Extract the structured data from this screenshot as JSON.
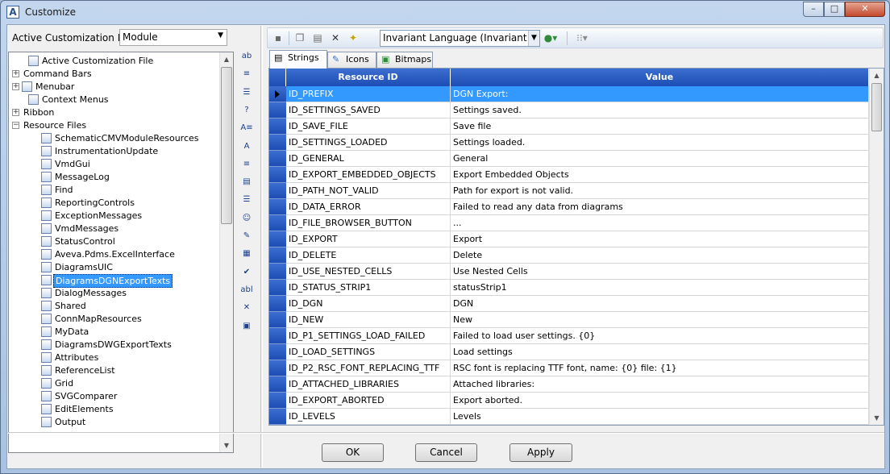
{
  "window": {
    "title": "Customize",
    "app_icon": "A",
    "minimize": "–",
    "maximize": "□",
    "close": "✕"
  },
  "left_panel": {
    "acf_label": "Active Customization File",
    "acf_value": "Module",
    "tree": [
      {
        "label": "Active Customization File",
        "level": 1,
        "expander": "",
        "icon": "file-icon"
      },
      {
        "label": "Command Bars",
        "level": 0,
        "expander": "+",
        "icon": ""
      },
      {
        "label": "Menubar",
        "level": 0,
        "expander": "+",
        "icon": "menu-icon"
      },
      {
        "label": "Context Menus",
        "level": 1,
        "expander": "",
        "icon": "context-menu-icon"
      },
      {
        "label": "Ribbon",
        "level": 0,
        "expander": "+",
        "icon": ""
      },
      {
        "label": "Resource Files",
        "level": 0,
        "expander": "−",
        "icon": ""
      },
      {
        "label": "SchematicCMVModuleResources",
        "level": 2,
        "expander": "",
        "icon": "resource-icon"
      },
      {
        "label": "InstrumentationUpdate",
        "level": 2,
        "expander": "",
        "icon": "resource-icon"
      },
      {
        "label": "VmdGui",
        "level": 2,
        "expander": "",
        "icon": "resource-icon"
      },
      {
        "label": "MessageLog",
        "level": 2,
        "expander": "",
        "icon": "resource-icon"
      },
      {
        "label": "Find",
        "level": 2,
        "expander": "",
        "icon": "resource-icon"
      },
      {
        "label": "ReportingControls",
        "level": 2,
        "expander": "",
        "icon": "resource-icon"
      },
      {
        "label": "ExceptionMessages",
        "level": 2,
        "expander": "",
        "icon": "resource-icon"
      },
      {
        "label": "VmdMessages",
        "level": 2,
        "expander": "",
        "icon": "resource-icon"
      },
      {
        "label": "StatusControl",
        "level": 2,
        "expander": "",
        "icon": "resource-icon"
      },
      {
        "label": "Aveva.Pdms.ExcelInterface",
        "level": 2,
        "expander": "",
        "icon": "resource-icon"
      },
      {
        "label": "DiagramsUIC",
        "level": 2,
        "expander": "",
        "icon": "resource-icon"
      },
      {
        "label": "DiagramsDGNExportTexts",
        "level": 2,
        "expander": "",
        "icon": "resource-icon",
        "selected": true
      },
      {
        "label": "DialogMessages",
        "level": 2,
        "expander": "",
        "icon": "resource-icon"
      },
      {
        "label": "Shared",
        "level": 2,
        "expander": "",
        "icon": "resource-icon"
      },
      {
        "label": "ConnMapResources",
        "level": 2,
        "expander": "",
        "icon": "resource-icon"
      },
      {
        "label": "MyData",
        "level": 2,
        "expander": "",
        "icon": "resource-icon"
      },
      {
        "label": "DiagramsDWGExportTexts",
        "level": 2,
        "expander": "",
        "icon": "resource-icon"
      },
      {
        "label": "Attributes",
        "level": 2,
        "expander": "",
        "icon": "resource-icon"
      },
      {
        "label": "ReferenceList",
        "level": 2,
        "expander": "",
        "icon": "resource-icon"
      },
      {
        "label": "Grid",
        "level": 2,
        "expander": "",
        "icon": "resource-icon"
      },
      {
        "label": "SVGComparer",
        "level": 2,
        "expander": "",
        "icon": "resource-icon"
      },
      {
        "label": "EditElements",
        "level": 2,
        "expander": "",
        "icon": "resource-icon"
      },
      {
        "label": "Output",
        "level": 2,
        "expander": "",
        "icon": "resource-icon"
      }
    ]
  },
  "vertical_toolbar": [
    {
      "icon": "textbox-icon",
      "glyph": "ab"
    },
    {
      "icon": "combobox-icon",
      "glyph": "≡"
    },
    {
      "icon": "list-icon",
      "glyph": "☰"
    },
    {
      "icon": "help-icon",
      "glyph": "?"
    },
    {
      "icon": "label-icon",
      "glyph": "A≡"
    },
    {
      "icon": "font-icon",
      "glyph": "A"
    },
    {
      "icon": "combo-list-icon",
      "glyph": "≡"
    },
    {
      "icon": "panel-icon",
      "glyph": "▤"
    },
    {
      "icon": "listview-icon",
      "glyph": "☰"
    },
    {
      "icon": "smiley-icon",
      "glyph": "☺"
    },
    {
      "icon": "edit-list-icon",
      "glyph": "✎"
    },
    {
      "icon": "image-list-icon",
      "glyph": "▦"
    },
    {
      "icon": "checkbox-icon",
      "glyph": "✔"
    },
    {
      "icon": "abl-textbox-icon",
      "glyph": "abl"
    },
    {
      "icon": "delete-icon",
      "glyph": "✕"
    },
    {
      "icon": "image-icon",
      "glyph": "▣"
    }
  ],
  "toolbar": {
    "language_value": "Invariant Language (Invariant C",
    "icons": [
      "save-icon",
      "copy-icon",
      "paste-icon",
      "delete-icon",
      "new-resource-icon",
      "globe-icon",
      "grid-options-icon"
    ]
  },
  "tabs": [
    {
      "label": "Strings",
      "icon": "strings-tab-icon",
      "active": true
    },
    {
      "label": "Icons",
      "icon": "icons-tab-icon",
      "active": false
    },
    {
      "label": "Bitmaps",
      "icon": "bitmaps-tab-icon",
      "active": false
    }
  ],
  "grid": {
    "columns": [
      "Resource ID",
      "Value"
    ],
    "rows": [
      [
        "ID_PREFIX",
        "DGN Export:"
      ],
      [
        "ID_SETTINGS_SAVED",
        "Settings saved."
      ],
      [
        "ID_SAVE_FILE",
        "Save file"
      ],
      [
        "ID_SETTINGS_LOADED",
        "Settings loaded."
      ],
      [
        "ID_GENERAL",
        "General"
      ],
      [
        "ID_EXPORT_EMBEDDED_OBJECTS",
        "Export Embedded Objects"
      ],
      [
        "ID_PATH_NOT_VALID",
        "Path for export is not valid."
      ],
      [
        "ID_DATA_ERROR",
        "Failed to read any data from diagrams"
      ],
      [
        "ID_FILE_BROWSER_BUTTON",
        "..."
      ],
      [
        "ID_EXPORT",
        "Export"
      ],
      [
        "ID_DELETE",
        "Delete"
      ],
      [
        "ID_USE_NESTED_CELLS",
        "Use Nested Cells"
      ],
      [
        "ID_STATUS_STRIP1",
        "statusStrip1"
      ],
      [
        "ID_DGN",
        "DGN"
      ],
      [
        "ID_NEW",
        "New"
      ],
      [
        "ID_P1_SETTINGS_LOAD_FAILED",
        "Failed to load user settings. {0}"
      ],
      [
        "ID_LOAD_SETTINGS",
        "Load settings"
      ],
      [
        "ID_P2_RSC_FONT_REPLACING_TTF",
        "RSC font is replacing TTF font, name: {0} file: {1}"
      ],
      [
        "ID_ATTACHED_LIBRARIES",
        "Attached libraries:"
      ],
      [
        "ID_EXPORT_ABORTED",
        "Export aborted."
      ],
      [
        "ID_LEVELS",
        "Levels"
      ]
    ],
    "selected_row": 0
  },
  "buttons": {
    "ok": "OK",
    "cancel": "Cancel",
    "apply": "Apply"
  },
  "colors": {
    "selection": "#3399ff",
    "grid_header": "#2457c2"
  }
}
